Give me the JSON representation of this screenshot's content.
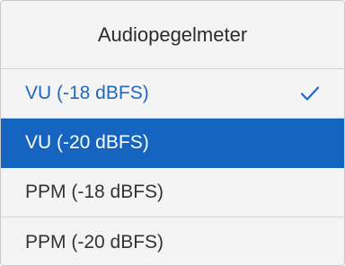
{
  "menu": {
    "title": "Audiopegelmeter",
    "items": [
      {
        "label": "VU (-18 dBFS)",
        "checked": true,
        "selected": false
      },
      {
        "label": "VU (-20 dBFS)",
        "checked": false,
        "selected": true
      },
      {
        "label": "PPM (-18 dBFS)",
        "checked": false,
        "selected": false
      },
      {
        "label": "PPM (-20 dBFS)",
        "checked": false,
        "selected": false
      }
    ]
  },
  "colors": {
    "accent_text": "#1f68bd",
    "highlight_background": "#1565c0",
    "menu_background": "#f4f4f4",
    "divider": "#d2d2d2"
  },
  "icons": {
    "checked_item": "checkmark-icon"
  }
}
